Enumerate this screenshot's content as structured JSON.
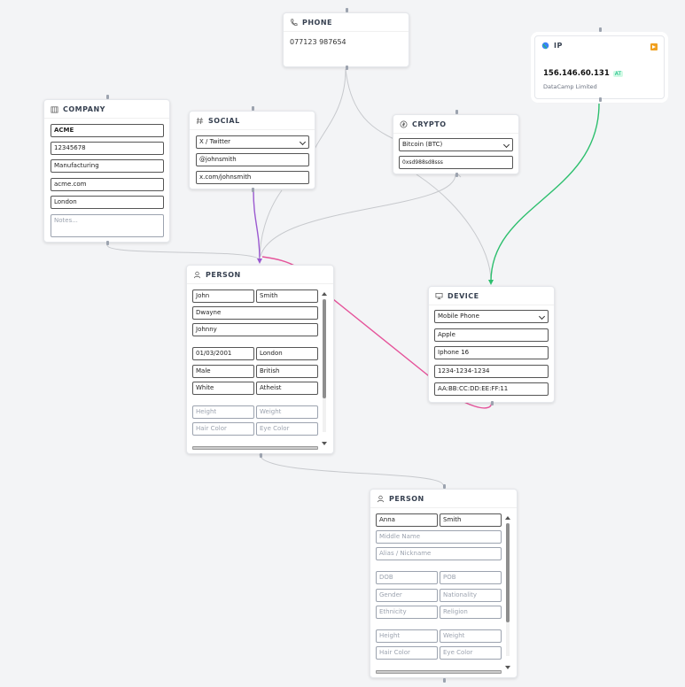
{
  "colors": {
    "edge_default": "#c7c9cd",
    "edge_social": "#9b59d0",
    "edge_pink": "#e5539a",
    "edge_green": "#2dbf6e",
    "handle": "#9ca3af",
    "ip_badge": "#f0a020",
    "at_badge_bg": "#d1fae5",
    "at_badge_text": "#10b981"
  },
  "phone": {
    "title": "PHONE",
    "icon": "phone-icon",
    "number": "077123 987654"
  },
  "ip": {
    "title": "IP",
    "icon": "globe-icon",
    "badge_icon": "play-icon",
    "address": "156.146.60.131",
    "country": "AT",
    "isp": "DataCamp Limited"
  },
  "company": {
    "title": "COMPANY",
    "icon": "building-icon",
    "name": "ACME",
    "number": "12345678",
    "industry": "Manufacturing",
    "website": "acme.com",
    "location": "London",
    "notes_placeholder": "Notes..."
  },
  "social": {
    "title": "SOCIAL",
    "icon": "hash-icon",
    "platform": "X / Twitter",
    "handle": "@johnsmith",
    "url": "x.com/johnsmith"
  },
  "crypto": {
    "title": "CRYPTO",
    "icon": "coin-icon",
    "currency": "Bitcoin (BTC)",
    "address": "0xsd988sd8sss"
  },
  "device": {
    "title": "DEVICE",
    "icon": "device-icon",
    "type": "Mobile Phone",
    "make": "Apple",
    "model": "Iphone 16",
    "imei": "1234-1234-1234",
    "mac": "AA:BB:CC:DD:EE:FF:11"
  },
  "person1": {
    "title": "PERSON",
    "icon": "person-icon",
    "first": "John",
    "last": "Smith",
    "middle": "Dwayne",
    "alias": "Johnny",
    "dob": "01/03/2001",
    "pob": "London",
    "gender": "Male",
    "nationality": "British",
    "ethnicity": "White",
    "religion": "Atheist",
    "height_ph": "Height",
    "weight_ph": "Weight",
    "hair_ph": "Hair Color",
    "eye_ph": "Eye Color"
  },
  "person2": {
    "title": "PERSON",
    "icon": "person-icon",
    "first": "Anna",
    "last": "Smith",
    "middle_ph": "Middle Name",
    "alias_ph": "Alias / Nickname",
    "dob_ph": "DOB",
    "pob_ph": "POB",
    "gender_ph": "Gender",
    "nationality_ph": "Nationality",
    "ethnicity_ph": "Ethnicity",
    "religion_ph": "Religion",
    "height_ph": "Height",
    "weight_ph": "Weight",
    "hair_ph": "Hair Color",
    "eye_ph": "Eye Color"
  }
}
